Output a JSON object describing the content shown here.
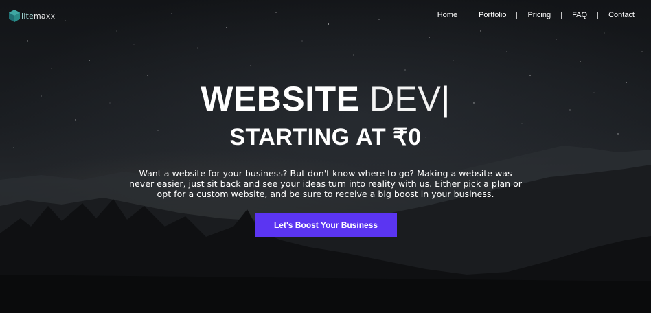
{
  "brand": {
    "logo_prefix": "lite",
    "logo_suffix": "maxx",
    "accent_color": "#5b35f2",
    "logo_colors": [
      "#1f6f73",
      "#3fa7a3",
      "#9fd3d0"
    ]
  },
  "nav": {
    "items": [
      {
        "label": "Home"
      },
      {
        "label": "Portfolio"
      },
      {
        "label": "Pricing"
      },
      {
        "label": "FAQ"
      },
      {
        "label": "Contact"
      }
    ]
  },
  "hero": {
    "headline_bold": "WEBSITE",
    "headline_light": "DEV",
    "headline_caret": "|",
    "subheadline_text": "STARTING AT",
    "subheadline_amount": "₹0",
    "description": "Want a website for your business? But don't know where to go? Making a website was never easier, just sit back and see your ideas turn into reality with us. Either pick a plan or opt for a custom website, and be sure to receive a big boost in your business.",
    "cta_label": "Let's Boost Your Business",
    "background": "night-sky-mountains"
  }
}
